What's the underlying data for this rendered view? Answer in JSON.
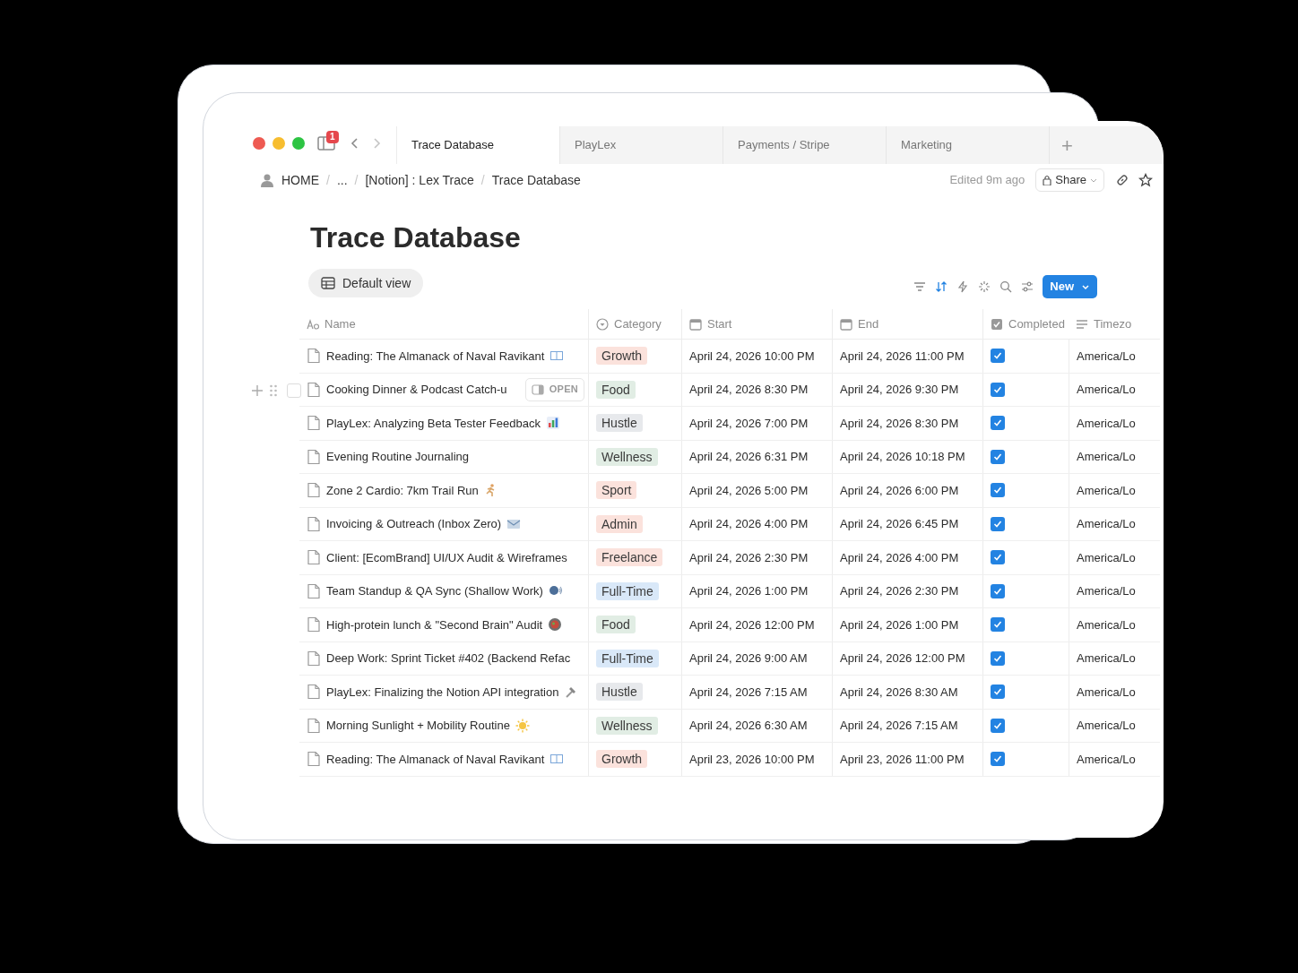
{
  "window": {
    "notification_count": "1"
  },
  "tabs": [
    {
      "label": "Trace Database",
      "selected": true
    },
    {
      "label": "PlayLex",
      "selected": false
    },
    {
      "label": "Payments / Stripe",
      "selected": false
    },
    {
      "label": "Marketing",
      "selected": false
    }
  ],
  "new_tab_button": "+",
  "breadcrumbs": [
    {
      "label": "HOME"
    },
    {
      "separator": "/",
      "label": "..."
    },
    {
      "separator": "/",
      "label": "[Notion] : Lex Trace"
    },
    {
      "separator": "/",
      "label": "Trace Database"
    }
  ],
  "edited": "Edited 9m ago",
  "share_button": "Share",
  "page_title": "Trace Database",
  "view_tab": "Default view",
  "toolbar": {
    "sort_active": true,
    "new_button": "New"
  },
  "columns": [
    {
      "label": "Name",
      "kind": "title"
    },
    {
      "label": "Category",
      "kind": "select"
    },
    {
      "label": "Start",
      "kind": "date"
    },
    {
      "label": "End",
      "kind": "date"
    },
    {
      "label": "Completed",
      "kind": "checkbox"
    },
    {
      "label": "Timezo",
      "kind": "text"
    }
  ],
  "open_button": "OPEN",
  "rows": [
    {
      "name": "Reading: The Almanack of Naval Ravikant",
      "kind": "book",
      "hovered": false,
      "selected": false,
      "category": "Growth",
      "color": "#fbe2dc",
      "start": "April 24, 2026 10:00 PM",
      "end": "April 24, 2026 11:00 PM",
      "completed": true,
      "timezone": "America/Lo"
    },
    {
      "name": "Cooking Dinner & Podcast Catch-u",
      "kind": "plain",
      "hovered": true,
      "selected": false,
      "category": "Food",
      "color": "#e1ede4",
      "start": "April 24, 2026 8:30 PM",
      "end": "April 24, 2026 9:30 PM",
      "completed": true,
      "timezone": "America/Lo"
    },
    {
      "name": "PlayLex: Analyzing Beta Tester Feedback",
      "kind": "chart",
      "hovered": false,
      "selected": false,
      "category": "Hustle",
      "color": "#e7e9ec",
      "start": "April 24, 2026 7:00 PM",
      "end": "April 24, 2026 8:30 PM",
      "completed": true,
      "timezone": "America/Lo"
    },
    {
      "name": "Evening Routine Journaling",
      "kind": "plain",
      "hovered": false,
      "selected": false,
      "category": "Wellness",
      "color": "#e1ede4",
      "start": "April 24, 2026 6:31 PM",
      "end": "April 24, 2026 10:18 PM",
      "completed": true,
      "timezone": "America/Lo"
    },
    {
      "name": "Zone 2 Cardio: 7km Trail Run",
      "kind": "runner",
      "hovered": false,
      "selected": false,
      "category": "Sport",
      "color": "#fbe2dc",
      "start": "April 24, 2026 5:00 PM",
      "end": "April 24, 2026 6:00 PM",
      "completed": true,
      "timezone": "America/Lo"
    },
    {
      "name": "Invoicing & Outreach (Inbox Zero)",
      "kind": "mail",
      "hovered": false,
      "selected": false,
      "category": "Admin",
      "color": "#fbe2dc",
      "start": "April 24, 2026 4:00 PM",
      "end": "April 24, 2026 6:45 PM",
      "completed": true,
      "timezone": "America/Lo"
    },
    {
      "name": "Client: [EcomBrand] UI/UX Audit & Wireframes",
      "kind": "plain",
      "hovered": false,
      "selected": false,
      "category": "Freelance",
      "color": "#fbe2dc",
      "start": "April 24, 2026 2:30 PM",
      "end": "April 24, 2026 4:00 PM",
      "completed": true,
      "timezone": "America/Lo"
    },
    {
      "name": "Team Standup & QA Sync (Shallow Work)",
      "kind": "speech",
      "hovered": false,
      "selected": false,
      "category": "Full-Time",
      "color": "#d9e8f8",
      "start": "April 24, 2026 1:00 PM",
      "end": "April 24, 2026 2:30 PM",
      "completed": true,
      "timezone": "America/Lo"
    },
    {
      "name": "High-protein lunch & \"Second Brain\" Audit",
      "kind": "plate",
      "hovered": false,
      "selected": false,
      "category": "Food",
      "color": "#e1ede4",
      "start": "April 24, 2026 12:00 PM",
      "end": "April 24, 2026 1:00 PM",
      "completed": true,
      "timezone": "America/Lo"
    },
    {
      "name": "Deep Work: Sprint Ticket #402 (Backend Refac",
      "kind": "plain",
      "hovered": false,
      "selected": false,
      "category": "Full-Time",
      "color": "#d9e8f8",
      "start": "April 24, 2026 9:00 AM",
      "end": "April 24, 2026 12:00 PM",
      "completed": true,
      "timezone": "America/Lo"
    },
    {
      "name": "PlayLex: Finalizing the Notion API integration",
      "kind": "hammer",
      "hovered": false,
      "selected": false,
      "category": "Hustle",
      "color": "#e7e9ec",
      "start": "April 24, 2026 7:15 AM",
      "end": "April 24, 2026 8:30 AM",
      "completed": true,
      "timezone": "America/Lo"
    },
    {
      "name": "Morning Sunlight + Mobility Routine",
      "kind": "sun",
      "hovered": false,
      "selected": false,
      "category": "Wellness",
      "color": "#e1ede4",
      "start": "April 24, 2026 6:30 AM",
      "end": "April 24, 2026 7:15 AM",
      "completed": true,
      "timezone": "America/Lo"
    },
    {
      "name": "Reading: The Almanack of Naval Ravikant",
      "kind": "book",
      "hovered": false,
      "selected": false,
      "category": "Growth",
      "color": "#fbe2dc",
      "start": "April 23, 2026 10:00 PM",
      "end": "April 23, 2026 11:00 PM",
      "completed": true,
      "timezone": "America/Lo"
    }
  ]
}
